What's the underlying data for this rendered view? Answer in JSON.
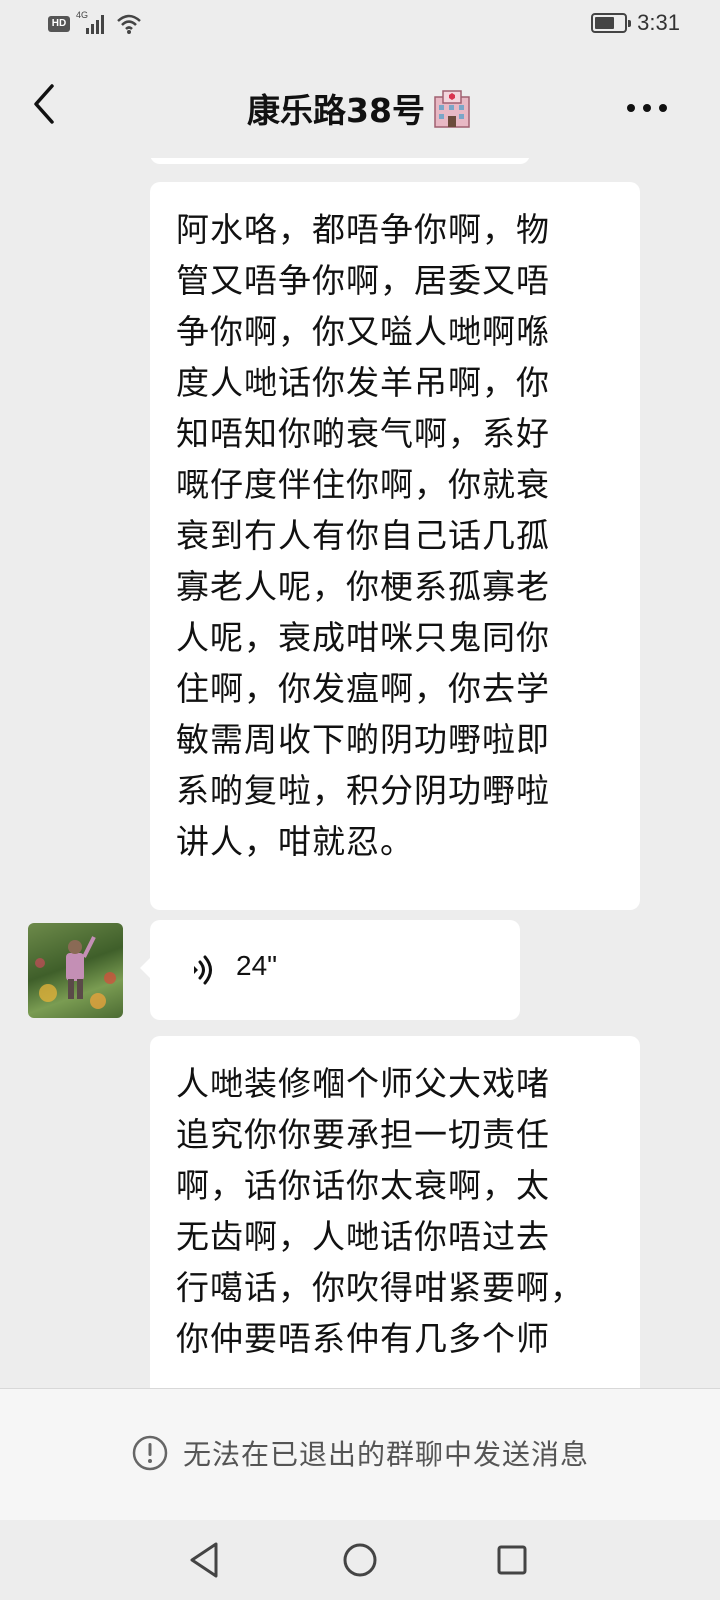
{
  "status_bar": {
    "network_badge": "HD",
    "network_type": "4G",
    "time": "3:31",
    "battery_level": 0.6
  },
  "header": {
    "title": "康乐路38号",
    "title_emoji": "hospital-emoji",
    "back_icon": "chevron-left-icon",
    "more_icon": "more-horizontal-icon"
  },
  "messages": [
    {
      "type": "text",
      "text": "阿水咯，都唔争你啊，物\n管又唔争你啊，居委又唔\n争你啊，你又嗌人哋啊喺\n度人哋话你发羊吊啊，你\n知唔知你啲衰气啊，系好\n嘅仔度伴住你啊，你就衰\n衰到冇人有你自己话几孤\n寡老人呢，你梗系孤寡老\n人呢，衰成咁咪只鬼同你\n住啊，你发瘟啊，你去学\n敏需周收下啲阴功嘢啦即\n系啲复啦，积分阴功嘢啦\n讲人，咁就忍。"
    },
    {
      "type": "voice",
      "duration": "24\""
    },
    {
      "type": "text",
      "text": "人哋装修嗰个师父大戏啫\n追究你你要承担一切责任\n啊，话你话你太衰啊，太\n无齿啊，人哋话你唔过去\n行噶话，你吹得咁紧要啊，\n你仲要唔系仲有几多个师"
    }
  ],
  "footer": {
    "notice": "无法在已退出的群聊中发送消息",
    "notice_icon": "info-circle-icon"
  },
  "colors": {
    "background": "#ededed",
    "bubble": "#ffffff",
    "text": "#111111",
    "notice_text": "#555555"
  }
}
